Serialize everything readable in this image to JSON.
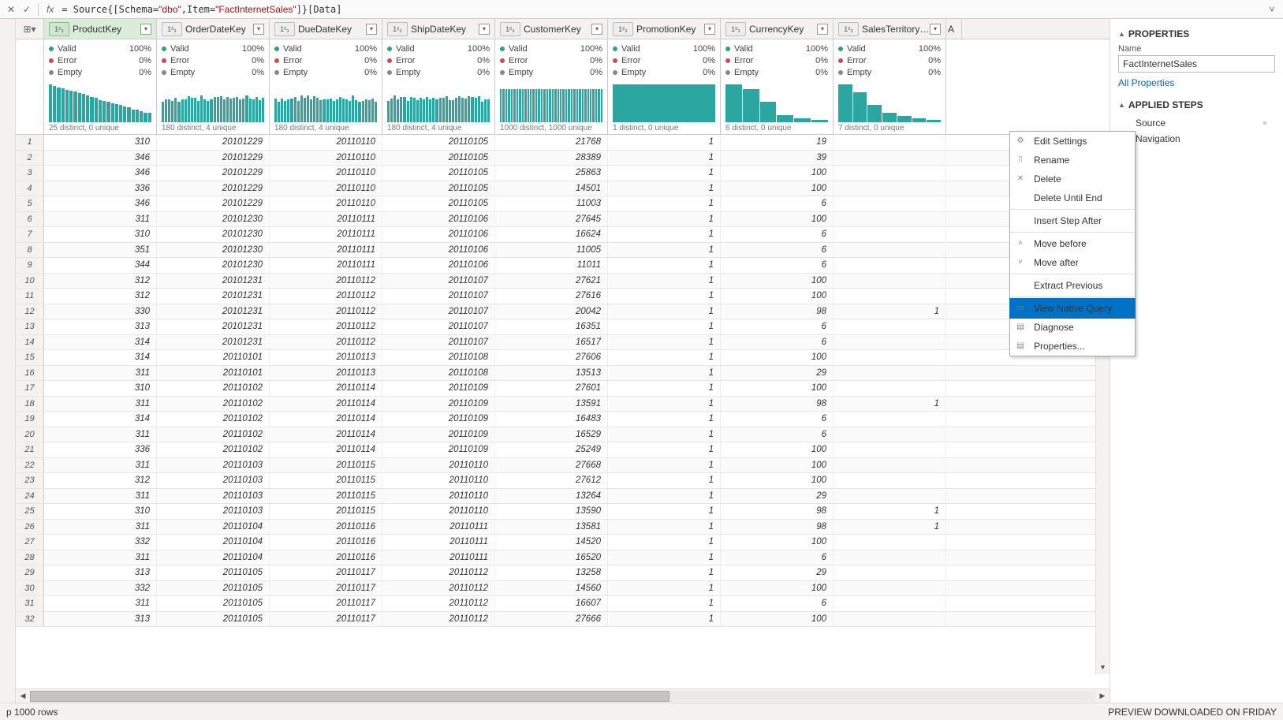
{
  "formula_bar": {
    "fx": "fx",
    "formula_html": "= Source{[Schema=<span class='str'>\"dbo\"</span>,Item=<span class='str'>\"FactInternetSales\"</span>]}[Data]"
  },
  "columns": [
    {
      "name": "ProductKey",
      "type": "1²₃",
      "selected": true,
      "distinct": "25 distinct, 0 unique",
      "spark": "desc_tall"
    },
    {
      "name": "OrderDateKey",
      "type": "1²₃",
      "distinct": "180 distinct, 4 unique",
      "spark": "uniform"
    },
    {
      "name": "DueDateKey",
      "type": "1²₃",
      "distinct": "180 distinct, 4 unique",
      "spark": "uniform"
    },
    {
      "name": "ShipDateKey",
      "type": "1²₃",
      "distinct": "180 distinct, 4 unique",
      "spark": "uniform"
    },
    {
      "name": "CustomerKey",
      "type": "1²₃",
      "distinct": "1000 distinct, 1000 unique",
      "spark": "uniform_short"
    },
    {
      "name": "PromotionKey",
      "type": "1²₃",
      "distinct": "1 distinct, 0 unique",
      "spark": "single"
    },
    {
      "name": "CurrencyKey",
      "type": "1²₃",
      "distinct": "6 distinct, 0 unique",
      "spark": "few"
    },
    {
      "name": "SalesTerritoryKey",
      "type": "1²₃",
      "distinct": "7 distinct, 0 unique",
      "spark": "few_desc"
    }
  ],
  "profile_labels": {
    "valid": "Valid",
    "error": "Error",
    "empty": "Empty"
  },
  "profile_values": {
    "valid": "100%",
    "error": "0%",
    "empty": "0%"
  },
  "rows": [
    [
      310,
      20101229,
      20110110,
      20110105,
      21768,
      1,
      19,
      ""
    ],
    [
      346,
      20101229,
      20110110,
      20110105,
      28389,
      1,
      39,
      ""
    ],
    [
      346,
      20101229,
      20110110,
      20110105,
      25863,
      1,
      100,
      ""
    ],
    [
      336,
      20101229,
      20110110,
      20110105,
      14501,
      1,
      100,
      ""
    ],
    [
      346,
      20101229,
      20110110,
      20110105,
      11003,
      1,
      6,
      ""
    ],
    [
      311,
      20101230,
      20110111,
      20110106,
      27645,
      1,
      100,
      ""
    ],
    [
      310,
      20101230,
      20110111,
      20110106,
      16624,
      1,
      6,
      ""
    ],
    [
      351,
      20101230,
      20110111,
      20110106,
      11005,
      1,
      6,
      ""
    ],
    [
      344,
      20101230,
      20110111,
      20110106,
      11011,
      1,
      6,
      ""
    ],
    [
      312,
      20101231,
      20110112,
      20110107,
      27621,
      1,
      100,
      ""
    ],
    [
      312,
      20101231,
      20110112,
      20110107,
      27616,
      1,
      100,
      ""
    ],
    [
      330,
      20101231,
      20110112,
      20110107,
      20042,
      1,
      98,
      "1"
    ],
    [
      313,
      20101231,
      20110112,
      20110107,
      16351,
      1,
      6,
      ""
    ],
    [
      314,
      20101231,
      20110112,
      20110107,
      16517,
      1,
      6,
      ""
    ],
    [
      314,
      20110101,
      20110113,
      20110108,
      27606,
      1,
      100,
      ""
    ],
    [
      311,
      20110101,
      20110113,
      20110108,
      13513,
      1,
      29,
      ""
    ],
    [
      310,
      20110102,
      20110114,
      20110109,
      27601,
      1,
      100,
      ""
    ],
    [
      311,
      20110102,
      20110114,
      20110109,
      13591,
      1,
      98,
      "1"
    ],
    [
      314,
      20110102,
      20110114,
      20110109,
      16483,
      1,
      6,
      ""
    ],
    [
      311,
      20110102,
      20110114,
      20110109,
      16529,
      1,
      6,
      ""
    ],
    [
      336,
      20110102,
      20110114,
      20110109,
      25249,
      1,
      100,
      ""
    ],
    [
      311,
      20110103,
      20110115,
      20110110,
      27668,
      1,
      100,
      ""
    ],
    [
      312,
      20110103,
      20110115,
      20110110,
      27612,
      1,
      100,
      ""
    ],
    [
      311,
      20110103,
      20110115,
      20110110,
      13264,
      1,
      29,
      ""
    ],
    [
      310,
      20110103,
      20110115,
      20110110,
      13590,
      1,
      98,
      "1"
    ],
    [
      311,
      20110104,
      20110116,
      20110111,
      13581,
      1,
      98,
      "1"
    ],
    [
      332,
      20110104,
      20110116,
      20110111,
      14520,
      1,
      100,
      ""
    ],
    [
      311,
      20110104,
      20110116,
      20110111,
      16520,
      1,
      6,
      ""
    ],
    [
      313,
      20110105,
      20110117,
      20110112,
      13258,
      1,
      29,
      ""
    ],
    [
      332,
      20110105,
      20110117,
      20110112,
      14560,
      1,
      100,
      ""
    ],
    [
      311,
      20110105,
      20110117,
      20110112,
      16607,
      1,
      6,
      ""
    ],
    [
      313,
      20110105,
      20110117,
      20110112,
      27666,
      1,
      100,
      ""
    ]
  ],
  "right_panel": {
    "properties_header": "PROPERTIES",
    "name_label": "Name",
    "name_value": "FactInternetSales",
    "all_props": "All Properties",
    "applied_header": "APPLIED STEPS",
    "steps": [
      "Source",
      "Navigation"
    ]
  },
  "context_menu": [
    {
      "label": "Edit Settings",
      "icon": "⚙"
    },
    {
      "label": "Rename",
      "icon": "⌷",
      "dis": true
    },
    {
      "label": "Delete",
      "icon": "✕"
    },
    {
      "label": "Delete Until End"
    },
    {
      "sep": true
    },
    {
      "label": "Insert Step After"
    },
    {
      "sep": true
    },
    {
      "label": "Move before",
      "icon": "˄",
      "dis": true
    },
    {
      "label": "Move after",
      "icon": "˅",
      "dis": true
    },
    {
      "sep": true
    },
    {
      "label": "Extract Previous",
      "dis": true
    },
    {
      "sep": true
    },
    {
      "label": "View Native Query",
      "icon": "▭",
      "hl": true
    },
    {
      "label": "Diagnose",
      "icon": "▤",
      "dis": true
    },
    {
      "label": "Properties...",
      "icon": "▤"
    }
  ],
  "last_col_letter": "A",
  "footer": {
    "left": "p 1000 rows",
    "right": "PREVIEW DOWNLOADED ON FRIDAY"
  }
}
